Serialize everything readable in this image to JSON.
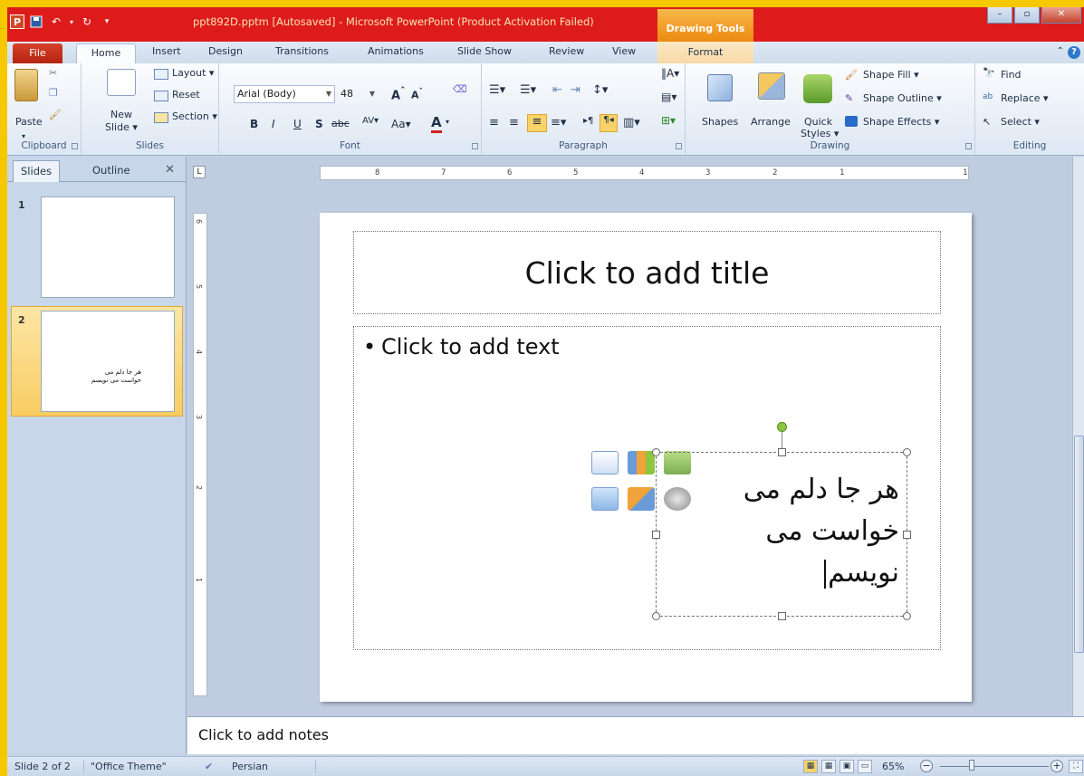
{
  "titlebar": {
    "app_icon": "P",
    "title": "ppt892D.pptm [Autosaved] - Microsoft PowerPoint (Product Activation Failed)",
    "contextual_tab_group": "Drawing Tools",
    "window_buttons": [
      "–",
      "▫",
      "✕"
    ]
  },
  "tabs": {
    "file": "File",
    "home": "Home",
    "insert": "Insert",
    "design": "Design",
    "transitions": "Transitions",
    "animations": "Animations",
    "slideshow": "Slide Show",
    "review": "Review",
    "view": "View",
    "format": "Format"
  },
  "ribbon": {
    "clipboard": {
      "label": "Clipboard",
      "paste": "Paste"
    },
    "slides": {
      "label": "Slides",
      "new_slide_1": "New",
      "new_slide_2": "Slide ▾",
      "layout": "Layout ▾",
      "reset": "Reset",
      "section": "Section ▾"
    },
    "font": {
      "label": "Font",
      "font_name": "Arial (Body)",
      "font_size": "48"
    },
    "paragraph": {
      "label": "Paragraph"
    },
    "drawing": {
      "label": "Drawing",
      "shapes": "Shapes",
      "arrange": "Arrange",
      "quick_styles_1": "Quick",
      "quick_styles_2": "Styles ▾",
      "shape_fill": "Shape Fill ▾",
      "shape_outline": "Shape Outline ▾",
      "shape_effects": "Shape Effects ▾"
    },
    "editing": {
      "label": "Editing",
      "find": "Find",
      "replace": "Replace ▾",
      "select": "Select ▾"
    }
  },
  "left_pane": {
    "tab_slides": "Slides",
    "tab_outline": "Outline",
    "close": "✕",
    "thumbs": [
      {
        "number": "1",
        "text": ""
      },
      {
        "number": "2",
        "text": "هر جا دلم می خواست می نویسم"
      }
    ]
  },
  "ruler": {
    "h_numbers": [
      "8",
      "7",
      "6",
      "5",
      "4",
      "3",
      "2",
      "1",
      "1"
    ],
    "v_numbers": [
      "6",
      "5",
      "4",
      "3",
      "2",
      "1"
    ]
  },
  "slide": {
    "title_placeholder": "Click to add title",
    "content_placeholder": "Click to add text",
    "textbox_lines": [
      "هر جا دلم می",
      "خواست می",
      "نویسم"
    ]
  },
  "notes": {
    "placeholder": "Click to add notes"
  },
  "statusbar": {
    "slide_info": "Slide 2 of 2",
    "theme": "\"Office Theme\"",
    "language": "Persian",
    "zoom": "65%"
  },
  "colors": {
    "title_bar": "#de1b1b",
    "highlight_frame": "#f5c800",
    "contextual_tab": "#f7a83a",
    "file_tab": "#c4301a"
  }
}
